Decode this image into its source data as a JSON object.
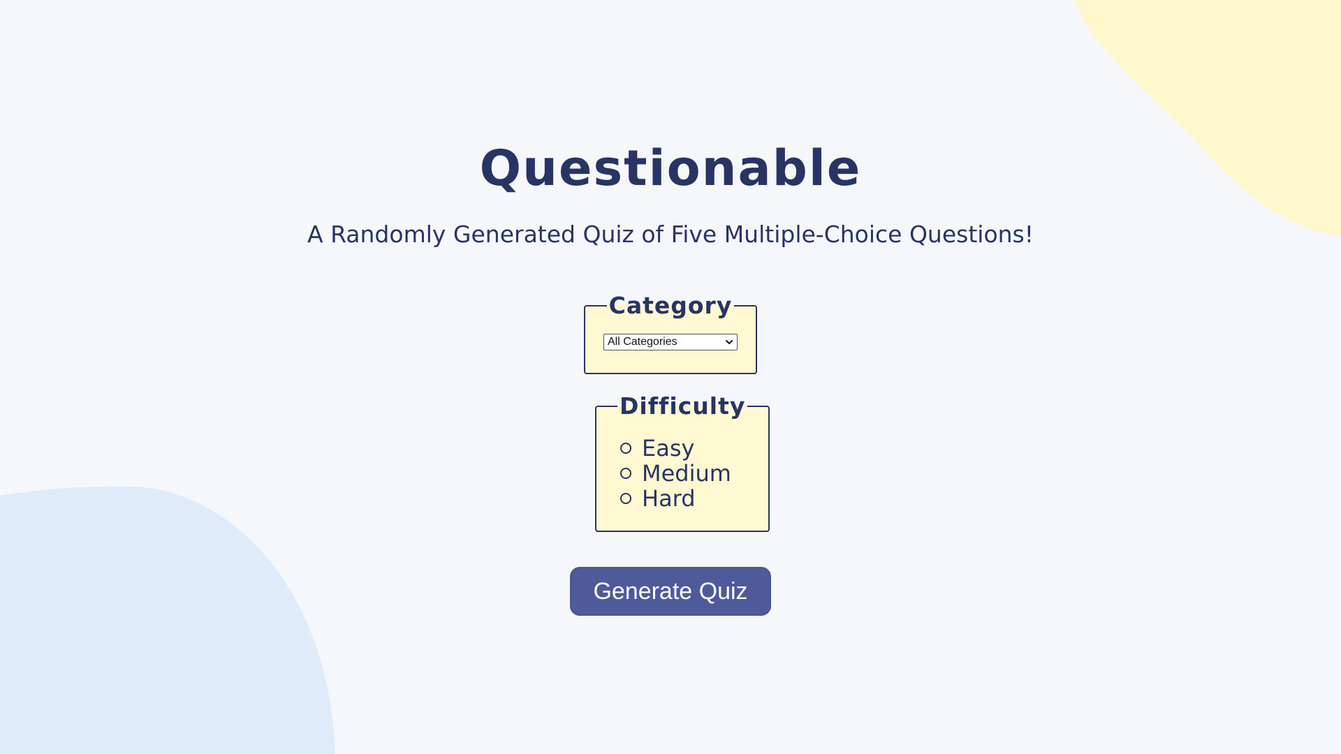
{
  "header": {
    "title": "Questionable",
    "subtitle": "A Randomly Generated Quiz of Five Multiple-Choice Questions!"
  },
  "category": {
    "legend": "Category",
    "selected": "All Categories",
    "icon": "chevron-down-icon"
  },
  "difficulty": {
    "legend": "Difficulty",
    "options": [
      {
        "label": "Easy",
        "checked": false
      },
      {
        "label": "Medium",
        "checked": false
      },
      {
        "label": "Hard",
        "checked": false
      }
    ]
  },
  "actions": {
    "generate_label": "Generate Quiz"
  },
  "colors": {
    "background": "#f5f7fb",
    "text": "#283464",
    "panel": "#fff9d2",
    "button": "#4f5a9b",
    "blob_yellow": "#fff8cc",
    "blob_blue": "#dfebf8"
  }
}
